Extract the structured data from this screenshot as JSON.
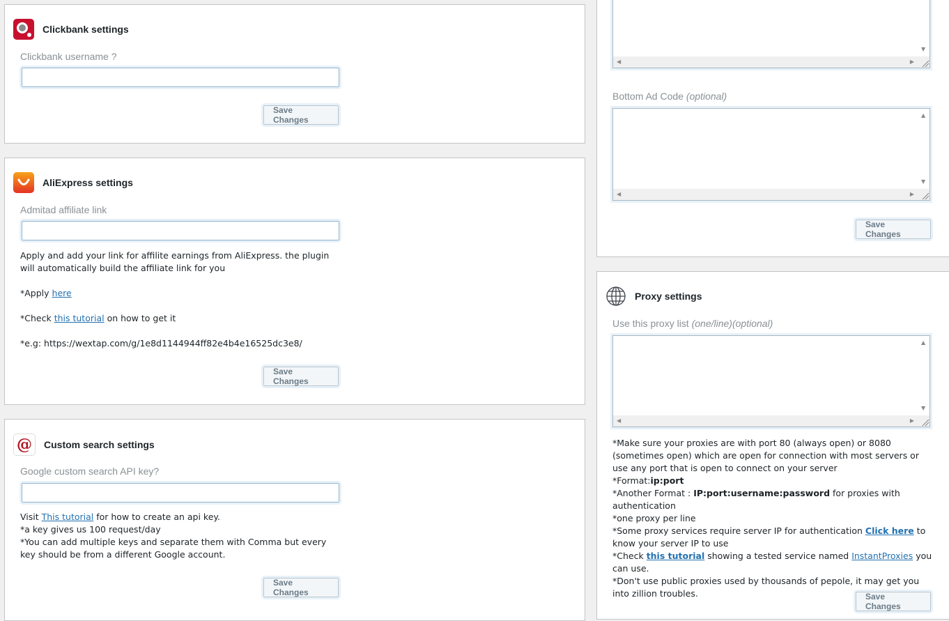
{
  "clickbank": {
    "title": "Clickbank settings",
    "username_label": "Clickbank username ?",
    "username_value": "",
    "save_label": "Save Changes"
  },
  "aliexpress": {
    "title": "AliExpress settings",
    "link_label": "Admitad affiliate link",
    "link_value": "",
    "desc_line1": "Apply and add your link for affilite earnings from AliExpress. the plugin will automatically build the affiliate link for you",
    "apply_prefix": "*Apply ",
    "apply_link": "here",
    "check_prefix": "*Check ",
    "check_link": "this tutorial",
    "check_suffix": " on how to get it",
    "example": "*e.g: https://wextap.com/g/1e8d1144944ff82e4b4e16525dc3e8/",
    "save_label": "Save Changes"
  },
  "custom_search": {
    "title": "Custom search settings",
    "key_label": "Google custom search API key?",
    "key_value": "",
    "visit_prefix": "Visit ",
    "visit_link": "This tutorial",
    "visit_suffix": " for how to create an api key.",
    "line2": "*a key gives us 100 request/day",
    "line3": "*You can add multiple keys and separate them with Comma but every key should be from a different Google account.",
    "save_label": "Save Changes"
  },
  "ads": {
    "bottom_label": "Bottom Ad Code ",
    "bottom_optional": "(optional)",
    "save_label": "Save Changes"
  },
  "proxy": {
    "title": "Proxy settings",
    "list_label": "Use this proxy list ",
    "list_optional": "(one/line)(optional)",
    "note1": "*Make sure your proxies are with port 80 (always open) or 8080 (sometimes open) which are open for connection with most servers or use any port that is open to connect on your server",
    "format_prefix": "*Format:",
    "format_value": "ip:port",
    "another_prefix": "*Another Format : ",
    "another_value": "IP:port:username:password",
    "another_suffix": " for proxies with authentication",
    "one_per_line": "*one proxy per line",
    "some_prefix": "*Some proxy services require server IP for authentication ",
    "click_here": "Click here",
    "some_suffix": " to know your server IP to use",
    "check_prefix": "*Check ",
    "check_link": "this tutorial",
    "check_mid": " showing a tested service named ",
    "check_link2": "InstantProxies",
    "check_suffix": " you can use.",
    "dont_use": "*Don't use public proxies used by thousands of pepole, it may get you into zillion troubles.",
    "save_label": "Save Changes"
  },
  "colors": {
    "accent": "#2271b1",
    "clickbank_brand": "#c8102e",
    "aliexpress_brand": "#e43225"
  }
}
